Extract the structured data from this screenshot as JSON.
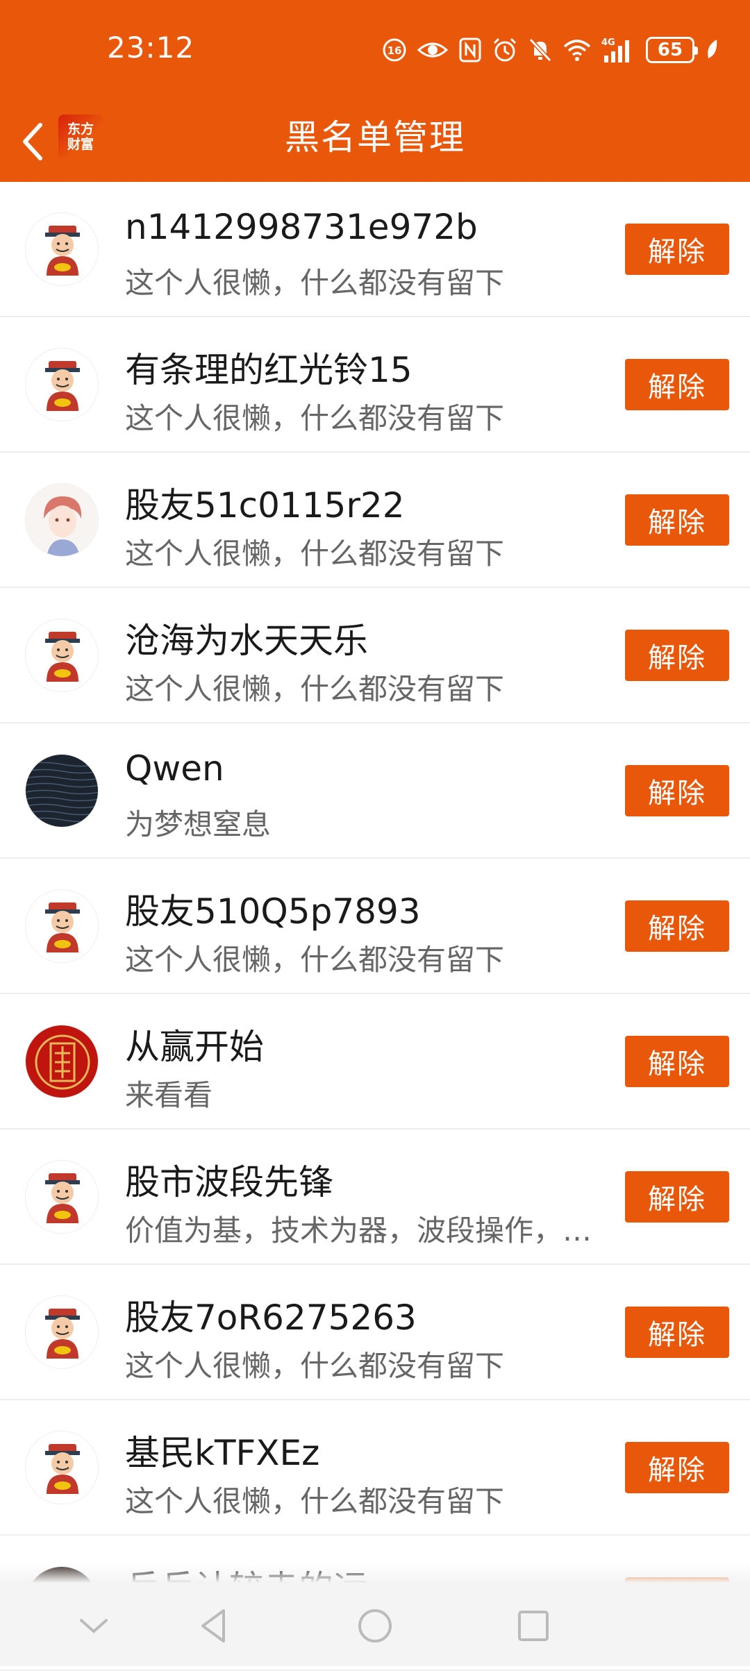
{
  "status_bar": {
    "time": "23:12",
    "battery": "65",
    "network": "4G"
  },
  "header": {
    "title": "黑名单管理",
    "logo_line1": "东方",
    "logo_line2": "财富"
  },
  "colors": {
    "accent": "#e8570a",
    "text_primary": "#1a1a1a",
    "text_secondary": "#666666"
  },
  "list": {
    "items": [
      {
        "name": "n1412998731e972b",
        "signature": "这个人很懒，什么都没有留下",
        "action": "解除",
        "avatar": "god-of-wealth-icon"
      },
      {
        "name": "有条理的红光铃15",
        "signature": "这个人很懒，什么都没有留下",
        "action": "解除",
        "avatar": "god-of-wealth-icon"
      },
      {
        "name": "股友51c0115r22",
        "signature": "这个人很懒，什么都没有留下",
        "action": "解除",
        "avatar": "anime-boy-avatar"
      },
      {
        "name": "沧海为水天天乐",
        "signature": "这个人很懒，什么都没有留下",
        "action": "解除",
        "avatar": "god-of-wealth-icon"
      },
      {
        "name": "Qwen",
        "signature": "为梦想窒息",
        "action": "解除",
        "avatar": "water-photo-avatar"
      },
      {
        "name": "股友510Q5p7893",
        "signature": "这个人很懒，什么都没有留下",
        "action": "解除",
        "avatar": "god-of-wealth-icon"
      },
      {
        "name": "从赢开始",
        "signature": "来看看",
        "action": "解除",
        "avatar": "red-seal-avatar"
      },
      {
        "name": "股市波段先锋",
        "signature": "价值为基，技术为器，波段操作，…",
        "action": "解除",
        "avatar": "god-of-wealth-icon"
      },
      {
        "name": "股友7oR6275263",
        "signature": "这个人很懒，什么都没有留下",
        "action": "解除",
        "avatar": "god-of-wealth-icon"
      },
      {
        "name": "基民kTFXEz",
        "signature": "这个人很懒，什么都没有留下",
        "action": "解除",
        "avatar": "god-of-wealth-icon"
      },
      {
        "name": "乒乒计较走的远",
        "signature": "",
        "action": "解除",
        "avatar": "dark-avatar"
      }
    ]
  },
  "system_nav": {
    "icons": [
      "chevron-down-icon",
      "back-triangle-icon",
      "home-circle-icon",
      "recents-square-icon"
    ]
  }
}
